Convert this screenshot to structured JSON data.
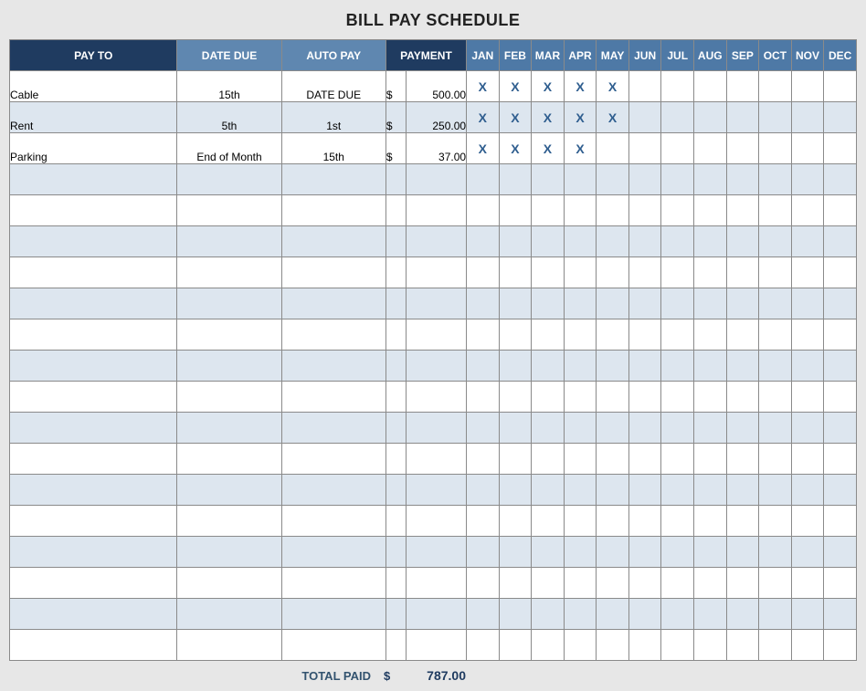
{
  "title": "BILL PAY SCHEDULE",
  "headers": {
    "payto": "PAY TO",
    "date_due": "DATE DUE",
    "auto_pay": "AUTO PAY",
    "payment": "PAYMENT"
  },
  "months": [
    "JAN",
    "FEB",
    "MAR",
    "APR",
    "MAY",
    "JUN",
    "JUL",
    "AUG",
    "SEP",
    "OCT",
    "NOV",
    "DEC"
  ],
  "currency": "$",
  "check_mark": "X",
  "rows": [
    {
      "payto": "Cable",
      "date_due": "15th",
      "auto_pay": "DATE DUE",
      "amount": "500.00",
      "checks": [
        true,
        true,
        true,
        true,
        true,
        false,
        false,
        false,
        false,
        false,
        false,
        false
      ]
    },
    {
      "payto": "Rent",
      "date_due": "5th",
      "auto_pay": "1st",
      "amount": "250.00",
      "checks": [
        true,
        true,
        true,
        true,
        true,
        false,
        false,
        false,
        false,
        false,
        false,
        false
      ]
    },
    {
      "payto": "Parking",
      "date_due": "End of Month",
      "auto_pay": "15th",
      "amount": "37.00",
      "checks": [
        true,
        true,
        true,
        true,
        false,
        false,
        false,
        false,
        false,
        false,
        false,
        false
      ]
    },
    {
      "payto": "",
      "date_due": "",
      "auto_pay": "",
      "amount": "",
      "checks": [
        false,
        false,
        false,
        false,
        false,
        false,
        false,
        false,
        false,
        false,
        false,
        false
      ]
    },
    {
      "payto": "",
      "date_due": "",
      "auto_pay": "",
      "amount": "",
      "checks": [
        false,
        false,
        false,
        false,
        false,
        false,
        false,
        false,
        false,
        false,
        false,
        false
      ]
    },
    {
      "payto": "",
      "date_due": "",
      "auto_pay": "",
      "amount": "",
      "checks": [
        false,
        false,
        false,
        false,
        false,
        false,
        false,
        false,
        false,
        false,
        false,
        false
      ]
    },
    {
      "payto": "",
      "date_due": "",
      "auto_pay": "",
      "amount": "",
      "checks": [
        false,
        false,
        false,
        false,
        false,
        false,
        false,
        false,
        false,
        false,
        false,
        false
      ]
    },
    {
      "payto": "",
      "date_due": "",
      "auto_pay": "",
      "amount": "",
      "checks": [
        false,
        false,
        false,
        false,
        false,
        false,
        false,
        false,
        false,
        false,
        false,
        false
      ]
    },
    {
      "payto": "",
      "date_due": "",
      "auto_pay": "",
      "amount": "",
      "checks": [
        false,
        false,
        false,
        false,
        false,
        false,
        false,
        false,
        false,
        false,
        false,
        false
      ]
    },
    {
      "payto": "",
      "date_due": "",
      "auto_pay": "",
      "amount": "",
      "checks": [
        false,
        false,
        false,
        false,
        false,
        false,
        false,
        false,
        false,
        false,
        false,
        false
      ]
    },
    {
      "payto": "",
      "date_due": "",
      "auto_pay": "",
      "amount": "",
      "checks": [
        false,
        false,
        false,
        false,
        false,
        false,
        false,
        false,
        false,
        false,
        false,
        false
      ]
    },
    {
      "payto": "",
      "date_due": "",
      "auto_pay": "",
      "amount": "",
      "checks": [
        false,
        false,
        false,
        false,
        false,
        false,
        false,
        false,
        false,
        false,
        false,
        false
      ]
    },
    {
      "payto": "",
      "date_due": "",
      "auto_pay": "",
      "amount": "",
      "checks": [
        false,
        false,
        false,
        false,
        false,
        false,
        false,
        false,
        false,
        false,
        false,
        false
      ]
    },
    {
      "payto": "",
      "date_due": "",
      "auto_pay": "",
      "amount": "",
      "checks": [
        false,
        false,
        false,
        false,
        false,
        false,
        false,
        false,
        false,
        false,
        false,
        false
      ]
    },
    {
      "payto": "",
      "date_due": "",
      "auto_pay": "",
      "amount": "",
      "checks": [
        false,
        false,
        false,
        false,
        false,
        false,
        false,
        false,
        false,
        false,
        false,
        false
      ]
    },
    {
      "payto": "",
      "date_due": "",
      "auto_pay": "",
      "amount": "",
      "checks": [
        false,
        false,
        false,
        false,
        false,
        false,
        false,
        false,
        false,
        false,
        false,
        false
      ]
    },
    {
      "payto": "",
      "date_due": "",
      "auto_pay": "",
      "amount": "",
      "checks": [
        false,
        false,
        false,
        false,
        false,
        false,
        false,
        false,
        false,
        false,
        false,
        false
      ]
    },
    {
      "payto": "",
      "date_due": "",
      "auto_pay": "",
      "amount": "",
      "checks": [
        false,
        false,
        false,
        false,
        false,
        false,
        false,
        false,
        false,
        false,
        false,
        false
      ]
    },
    {
      "payto": "",
      "date_due": "",
      "auto_pay": "",
      "amount": "",
      "checks": [
        false,
        false,
        false,
        false,
        false,
        false,
        false,
        false,
        false,
        false,
        false,
        false
      ]
    }
  ],
  "footer": {
    "label": "TOTAL PAID",
    "currency": "$",
    "amount": "787.00"
  }
}
